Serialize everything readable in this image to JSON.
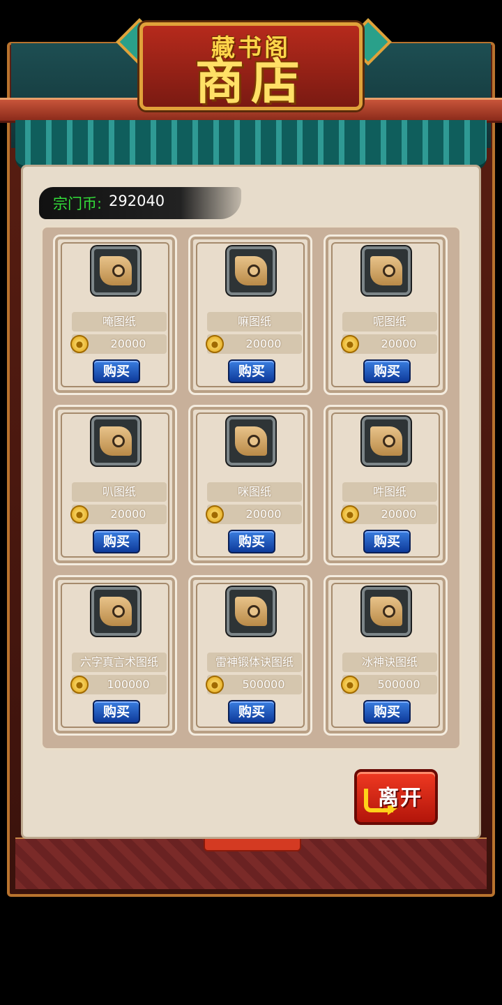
{
  "header": {
    "subtitle": "藏书阁",
    "title": "商店"
  },
  "currency": {
    "label": "宗门币:",
    "value": "292040"
  },
  "items": [
    {
      "name": "唵图纸",
      "price": "20000",
      "buy_label": "购买"
    },
    {
      "name": "嘛图纸",
      "price": "20000",
      "buy_label": "购买"
    },
    {
      "name": "呢图纸",
      "price": "20000",
      "buy_label": "购买"
    },
    {
      "name": "叭图纸",
      "price": "20000",
      "buy_label": "购买"
    },
    {
      "name": "咪图纸",
      "price": "20000",
      "buy_label": "购买"
    },
    {
      "name": "吽图纸",
      "price": "20000",
      "buy_label": "购买"
    },
    {
      "name": "六字真言术图纸",
      "price": "100000",
      "buy_label": "购买"
    },
    {
      "name": "雷神锻体诀图纸",
      "price": "500000",
      "buy_label": "购买"
    },
    {
      "name": "冰神诀图纸",
      "price": "500000",
      "buy_label": "购买"
    }
  ],
  "leave_button": {
    "label": "离开"
  },
  "colors": {
    "accent_gold": "#ffe066",
    "currency_green": "#33e03a",
    "buy_blue": "#1a56c0",
    "leave_red": "#d8200e"
  },
  "icons": {
    "item": "scroll-icon",
    "price": "coin-icon",
    "leave": "return-arrow-icon"
  }
}
